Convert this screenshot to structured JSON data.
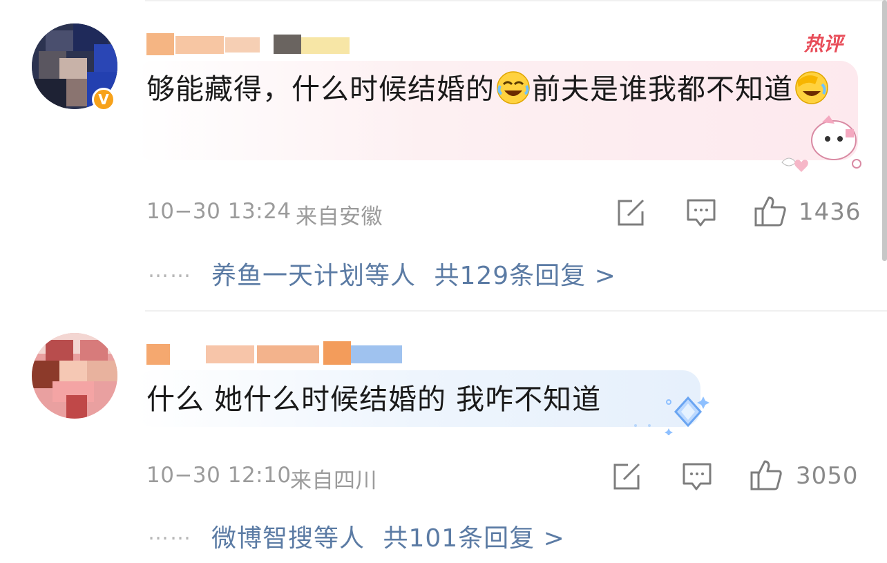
{
  "comments": [
    {
      "text_before_emoji": "够能藏得，什么时候结婚的",
      "text_after_emoji": "前夫是谁我都不知道",
      "emoji_1": "laughing-crying-emoji",
      "emoji_2": "facepalm-laughing-emoji",
      "badge": "热评",
      "timestamp": "10−30 13:24",
      "location": "来自安徽",
      "like_count": "1436",
      "replies_dots": "……",
      "replies_users": "养鱼一天计划等人",
      "replies_total": "共129条回复 >"
    },
    {
      "text": "什么 她什么时候结婚的 我咋不知道",
      "timestamp": "10−30 12:10",
      "location": "来自四川",
      "like_count": "3050",
      "replies_dots": "……",
      "replies_users": "微博智搜等人",
      "replies_total": "共101条回复 >"
    }
  ],
  "colors": {
    "reply_link": "#5b7ba4",
    "meta_text": "#9b9b9b",
    "hot_badge": "#e84d59",
    "verified_badge": "#f7a21b"
  }
}
